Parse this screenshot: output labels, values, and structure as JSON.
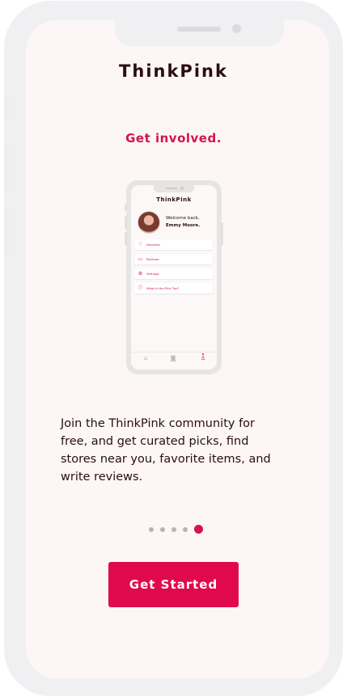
{
  "app": {
    "title": "ThinkPink"
  },
  "onboarding": {
    "headline": "Get involved.",
    "description": "Join the ThinkPink community for free, and get curated picks, find stores near you, favorite items, and write reviews.",
    "cta_label": "Get Started",
    "page_count": 5,
    "current_page": 5
  },
  "illustration": {
    "app_title": "ThinkPink",
    "welcome": "Welcome back,",
    "user_name": "Emmy Moore.",
    "menu": [
      {
        "label": "Favorites",
        "icon": "heart-icon"
      },
      {
        "label": "Reviews",
        "icon": "chat-icon"
      },
      {
        "label": "Settings",
        "icon": "gear-icon"
      },
      {
        "label": "What is the Pink Tax?",
        "icon": "question-icon"
      }
    ],
    "nav": [
      {
        "icon": "home-icon",
        "active": false
      },
      {
        "icon": "camera-icon",
        "active": false
      },
      {
        "icon": "profile-icon",
        "active": true
      }
    ]
  },
  "colors": {
    "accent": "#e0094e",
    "text": "#2a0e10",
    "background": "#fcf7f6",
    "dot_inactive": "#b8b3b4"
  }
}
